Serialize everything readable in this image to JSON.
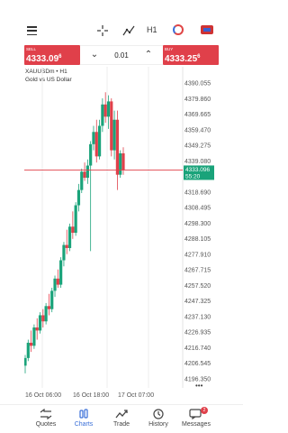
{
  "toolbar": {
    "timeframe": "H1",
    "icons": [
      "menu-icon",
      "crosshair-icon",
      "indicators-icon",
      "timeframe",
      "chart-style-icon",
      "flag-icon"
    ]
  },
  "trade": {
    "sell_caption": "SELL",
    "sell_price_main": "4333.09",
    "sell_price_sup": "6",
    "buy_caption": "BUY",
    "buy_price_main": "4333.25",
    "buy_price_sup": "6",
    "lot_value": "0.01",
    "lot_down_icon": "chevron-down-icon",
    "lot_up_icon": "chevron-up-icon",
    "colors": {
      "sell": "#e0404a",
      "buy": "#e0404a"
    }
  },
  "chart_header": {
    "symbol_line": "XAUUSDm • H1",
    "description": "Gold vs US Dollar"
  },
  "chart_data": {
    "type": "candlestick",
    "y_ticks": [
      "4390.055",
      "4379.860",
      "4369.665",
      "4359.470",
      "4349.275",
      "4339.080",
      "4318.690",
      "4308.495",
      "4298.300",
      "4288.105",
      "4277.910",
      "4267.715",
      "4257.520",
      "4247.325",
      "4237.130",
      "4226.935",
      "4216.740",
      "4206.545",
      "4196.350"
    ],
    "ylim": [
      4192,
      4394
    ],
    "x_ticks": [
      "16 Oct 06:00",
      "16 Oct 18:00",
      "17 Oct 07:00"
    ],
    "current_price": "4333.096",
    "countdown": "55:20",
    "candles": [
      [
        4205,
        4212,
        4200,
        4210
      ],
      [
        4210,
        4222,
        4208,
        4220
      ],
      [
        4220,
        4228,
        4214,
        4218
      ],
      [
        4218,
        4232,
        4216,
        4230
      ],
      [
        4230,
        4236,
        4222,
        4228
      ],
      [
        4228,
        4240,
        4226,
        4238
      ],
      [
        4238,
        4242,
        4230,
        4234
      ],
      [
        4234,
        4246,
        4232,
        4244
      ],
      [
        4244,
        4252,
        4238,
        4242
      ],
      [
        4242,
        4256,
        4240,
        4254
      ],
      [
        4254,
        4264,
        4250,
        4262
      ],
      [
        4262,
        4268,
        4256,
        4258
      ],
      [
        4258,
        4276,
        4256,
        4274
      ],
      [
        4274,
        4286,
        4270,
        4284
      ],
      [
        4284,
        4294,
        4278,
        4282
      ],
      [
        4282,
        4298,
        4280,
        4296
      ],
      [
        4296,
        4306,
        4288,
        4292
      ],
      [
        4292,
        4312,
        4290,
        4310
      ],
      [
        4310,
        4324,
        4306,
        4320
      ],
      [
        4320,
        4334,
        4318,
        4332
      ],
      [
        4332,
        4338,
        4326,
        4328
      ],
      [
        4328,
        4340,
        4324,
        4336
      ],
      [
        4336,
        4352,
        4280,
        4350
      ],
      [
        4350,
        4362,
        4346,
        4358
      ],
      [
        4358,
        4366,
        4338,
        4342
      ],
      [
        4342,
        4366,
        4340,
        4362
      ],
      [
        4362,
        4380,
        4358,
        4376
      ],
      [
        4376,
        4384,
        4364,
        4368
      ],
      [
        4368,
        4382,
        4360,
        4378
      ],
      [
        4378,
        4380,
        4342,
        4346
      ],
      [
        4346,
        4372,
        4340,
        4366
      ],
      [
        4366,
        4372,
        4320,
        4330
      ],
      [
        4330,
        4346,
        4328,
        4344
      ],
      [
        4344,
        4348,
        4330,
        4333
      ]
    ],
    "colors": {
      "up": "#1aa37a",
      "down": "#e0404a",
      "price_line": "#e0404a",
      "price_tag": "#1aa37a"
    }
  },
  "bottom_nav": {
    "items": [
      {
        "label": "Quotes",
        "icon": "quotes-icon"
      },
      {
        "label": "Charts",
        "icon": "charts-icon"
      },
      {
        "label": "Trade",
        "icon": "trade-icon"
      },
      {
        "label": "History",
        "icon": "history-icon"
      },
      {
        "label": "Messages",
        "icon": "messages-icon",
        "badge": "2"
      }
    ],
    "active": "Charts",
    "accent": "#3a6fd8"
  }
}
